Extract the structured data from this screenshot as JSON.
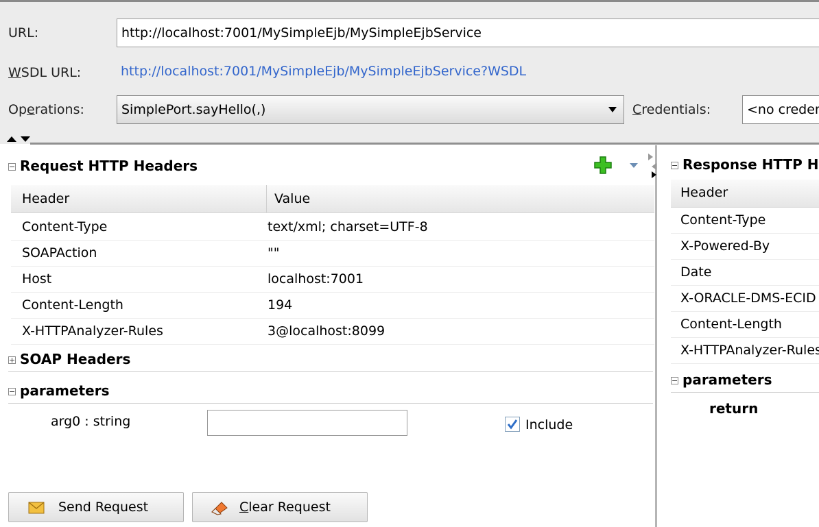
{
  "connection": {
    "url_label": "URL:",
    "url_value": "http://localhost:7001/MySimpleEjb/MySimpleEjbService",
    "wsdl_label_mnemonic": "W",
    "wsdl_label_rest": "SDL URL:",
    "wsdl_value": "http://localhost:7001/MySimpleEjb/MySimpleEjbService?WSDL",
    "operations_label_start": "Op",
    "operations_label_mnemonic": "e",
    "operations_label_end": "rations:",
    "operations_value": "SimplePort.sayHello(,)",
    "credentials_label_mnemonic": "C",
    "credentials_label_rest": "redentials:",
    "credentials_value": "<no credentials>"
  },
  "request": {
    "title": "Request HTTP Headers",
    "headers_columns": [
      "Header",
      "Value"
    ],
    "headers_rows": [
      {
        "header": "Content-Type",
        "value": "text/xml; charset=UTF-8"
      },
      {
        "header": "SOAPAction",
        "value": "\"\""
      },
      {
        "header": "Host",
        "value": "localhost:7001"
      },
      {
        "header": "Content-Length",
        "value": "194"
      },
      {
        "header": "X-HTTPAnalyzer-Rules",
        "value": "3@localhost:8099"
      }
    ],
    "soap_headers_title": "SOAP Headers",
    "parameters_title": "parameters",
    "param_label": "arg0 : string",
    "param_value": "",
    "include_label": "Include",
    "include_checked": true,
    "send_label": "Send Request",
    "clear_mnemonic": "C",
    "clear_rest": "lear Request"
  },
  "response": {
    "title": "Response HTTP Headers",
    "headers_columns": [
      "Header"
    ],
    "headers_rows": [
      {
        "header": "Content-Type"
      },
      {
        "header": "X-Powered-By"
      },
      {
        "header": "Date"
      },
      {
        "header": "X-ORACLE-DMS-ECID"
      },
      {
        "header": "Content-Length"
      },
      {
        "header": "X-HTTPAnalyzer-Rules"
      }
    ],
    "parameters_title": "parameters",
    "return_label": "return"
  },
  "colors": {
    "link": "#3366cc",
    "add_icon": "#2fae1c",
    "checkbox": "#2f6fc8",
    "envelope": "#f2c040"
  },
  "icons": [
    "add-icon",
    "dropdown-arrow-icon",
    "collapse-expand-icon",
    "checkbox-icon",
    "envelope-icon",
    "eraser-icon"
  ]
}
